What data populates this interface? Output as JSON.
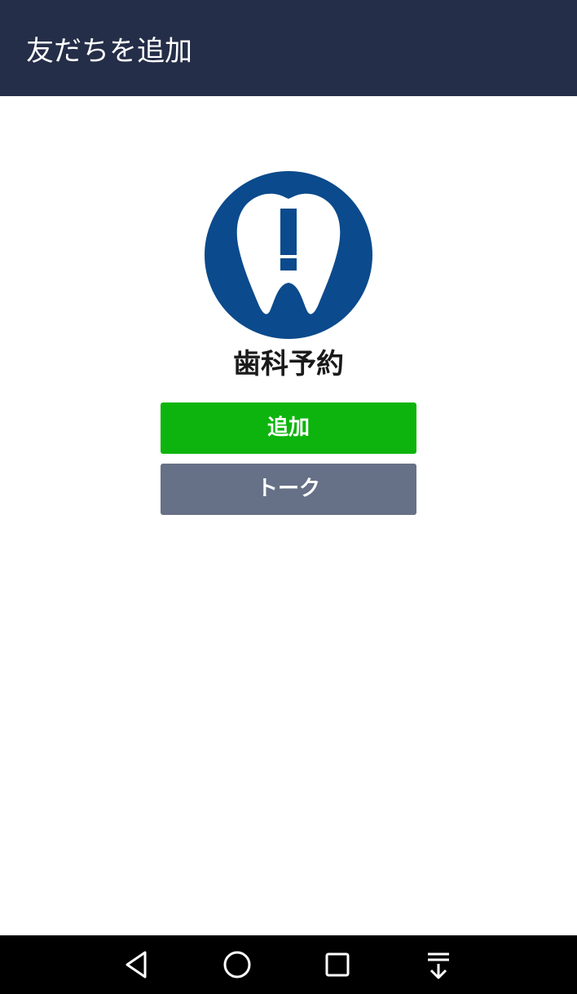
{
  "header": {
    "title": "友だちを追加"
  },
  "account": {
    "name": "歯科予約",
    "avatar_icon": "tooth-exclamation-icon",
    "avatar_color": "#0b4a8c"
  },
  "actions": {
    "add_label": "追加",
    "talk_label": "トーク",
    "add_color": "#0db40d",
    "talk_color": "#667087"
  },
  "navbar": {
    "items": [
      "back-icon",
      "home-icon",
      "recent-apps-icon",
      "notification-pulldown-icon"
    ]
  }
}
